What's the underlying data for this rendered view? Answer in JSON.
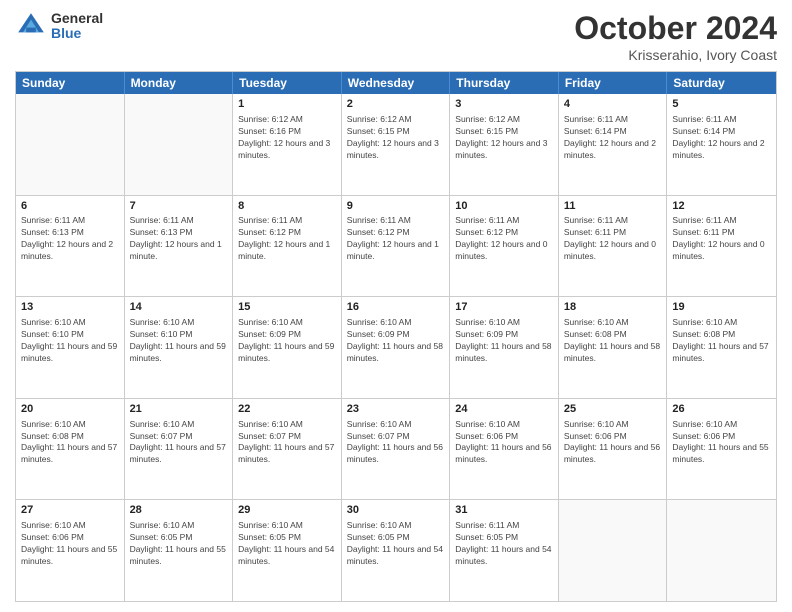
{
  "header": {
    "logo_general": "General",
    "logo_blue": "Blue",
    "month_title": "October 2024",
    "location": "Krisserahio, Ivory Coast"
  },
  "days_of_week": [
    "Sunday",
    "Monday",
    "Tuesday",
    "Wednesday",
    "Thursday",
    "Friday",
    "Saturday"
  ],
  "weeks": [
    [
      {
        "day": "",
        "empty": true
      },
      {
        "day": "",
        "empty": true
      },
      {
        "day": "1",
        "sunrise": "Sunrise: 6:12 AM",
        "sunset": "Sunset: 6:16 PM",
        "daylight": "Daylight: 12 hours and 3 minutes."
      },
      {
        "day": "2",
        "sunrise": "Sunrise: 6:12 AM",
        "sunset": "Sunset: 6:15 PM",
        "daylight": "Daylight: 12 hours and 3 minutes."
      },
      {
        "day": "3",
        "sunrise": "Sunrise: 6:12 AM",
        "sunset": "Sunset: 6:15 PM",
        "daylight": "Daylight: 12 hours and 3 minutes."
      },
      {
        "day": "4",
        "sunrise": "Sunrise: 6:11 AM",
        "sunset": "Sunset: 6:14 PM",
        "daylight": "Daylight: 12 hours and 2 minutes."
      },
      {
        "day": "5",
        "sunrise": "Sunrise: 6:11 AM",
        "sunset": "Sunset: 6:14 PM",
        "daylight": "Daylight: 12 hours and 2 minutes."
      }
    ],
    [
      {
        "day": "6",
        "sunrise": "Sunrise: 6:11 AM",
        "sunset": "Sunset: 6:13 PM",
        "daylight": "Daylight: 12 hours and 2 minutes."
      },
      {
        "day": "7",
        "sunrise": "Sunrise: 6:11 AM",
        "sunset": "Sunset: 6:13 PM",
        "daylight": "Daylight: 12 hours and 1 minute."
      },
      {
        "day": "8",
        "sunrise": "Sunrise: 6:11 AM",
        "sunset": "Sunset: 6:12 PM",
        "daylight": "Daylight: 12 hours and 1 minute."
      },
      {
        "day": "9",
        "sunrise": "Sunrise: 6:11 AM",
        "sunset": "Sunset: 6:12 PM",
        "daylight": "Daylight: 12 hours and 1 minute."
      },
      {
        "day": "10",
        "sunrise": "Sunrise: 6:11 AM",
        "sunset": "Sunset: 6:12 PM",
        "daylight": "Daylight: 12 hours and 0 minutes."
      },
      {
        "day": "11",
        "sunrise": "Sunrise: 6:11 AM",
        "sunset": "Sunset: 6:11 PM",
        "daylight": "Daylight: 12 hours and 0 minutes."
      },
      {
        "day": "12",
        "sunrise": "Sunrise: 6:11 AM",
        "sunset": "Sunset: 6:11 PM",
        "daylight": "Daylight: 12 hours and 0 minutes."
      }
    ],
    [
      {
        "day": "13",
        "sunrise": "Sunrise: 6:10 AM",
        "sunset": "Sunset: 6:10 PM",
        "daylight": "Daylight: 11 hours and 59 minutes."
      },
      {
        "day": "14",
        "sunrise": "Sunrise: 6:10 AM",
        "sunset": "Sunset: 6:10 PM",
        "daylight": "Daylight: 11 hours and 59 minutes."
      },
      {
        "day": "15",
        "sunrise": "Sunrise: 6:10 AM",
        "sunset": "Sunset: 6:09 PM",
        "daylight": "Daylight: 11 hours and 59 minutes."
      },
      {
        "day": "16",
        "sunrise": "Sunrise: 6:10 AM",
        "sunset": "Sunset: 6:09 PM",
        "daylight": "Daylight: 11 hours and 58 minutes."
      },
      {
        "day": "17",
        "sunrise": "Sunrise: 6:10 AM",
        "sunset": "Sunset: 6:09 PM",
        "daylight": "Daylight: 11 hours and 58 minutes."
      },
      {
        "day": "18",
        "sunrise": "Sunrise: 6:10 AM",
        "sunset": "Sunset: 6:08 PM",
        "daylight": "Daylight: 11 hours and 58 minutes."
      },
      {
        "day": "19",
        "sunrise": "Sunrise: 6:10 AM",
        "sunset": "Sunset: 6:08 PM",
        "daylight": "Daylight: 11 hours and 57 minutes."
      }
    ],
    [
      {
        "day": "20",
        "sunrise": "Sunrise: 6:10 AM",
        "sunset": "Sunset: 6:08 PM",
        "daylight": "Daylight: 11 hours and 57 minutes."
      },
      {
        "day": "21",
        "sunrise": "Sunrise: 6:10 AM",
        "sunset": "Sunset: 6:07 PM",
        "daylight": "Daylight: 11 hours and 57 minutes."
      },
      {
        "day": "22",
        "sunrise": "Sunrise: 6:10 AM",
        "sunset": "Sunset: 6:07 PM",
        "daylight": "Daylight: 11 hours and 57 minutes."
      },
      {
        "day": "23",
        "sunrise": "Sunrise: 6:10 AM",
        "sunset": "Sunset: 6:07 PM",
        "daylight": "Daylight: 11 hours and 56 minutes."
      },
      {
        "day": "24",
        "sunrise": "Sunrise: 6:10 AM",
        "sunset": "Sunset: 6:06 PM",
        "daylight": "Daylight: 11 hours and 56 minutes."
      },
      {
        "day": "25",
        "sunrise": "Sunrise: 6:10 AM",
        "sunset": "Sunset: 6:06 PM",
        "daylight": "Daylight: 11 hours and 56 minutes."
      },
      {
        "day": "26",
        "sunrise": "Sunrise: 6:10 AM",
        "sunset": "Sunset: 6:06 PM",
        "daylight": "Daylight: 11 hours and 55 minutes."
      }
    ],
    [
      {
        "day": "27",
        "sunrise": "Sunrise: 6:10 AM",
        "sunset": "Sunset: 6:06 PM",
        "daylight": "Daylight: 11 hours and 55 minutes."
      },
      {
        "day": "28",
        "sunrise": "Sunrise: 6:10 AM",
        "sunset": "Sunset: 6:05 PM",
        "daylight": "Daylight: 11 hours and 55 minutes."
      },
      {
        "day": "29",
        "sunrise": "Sunrise: 6:10 AM",
        "sunset": "Sunset: 6:05 PM",
        "daylight": "Daylight: 11 hours and 54 minutes."
      },
      {
        "day": "30",
        "sunrise": "Sunrise: 6:10 AM",
        "sunset": "Sunset: 6:05 PM",
        "daylight": "Daylight: 11 hours and 54 minutes."
      },
      {
        "day": "31",
        "sunrise": "Sunrise: 6:11 AM",
        "sunset": "Sunset: 6:05 PM",
        "daylight": "Daylight: 11 hours and 54 minutes."
      },
      {
        "day": "",
        "empty": true
      },
      {
        "day": "",
        "empty": true
      }
    ]
  ]
}
